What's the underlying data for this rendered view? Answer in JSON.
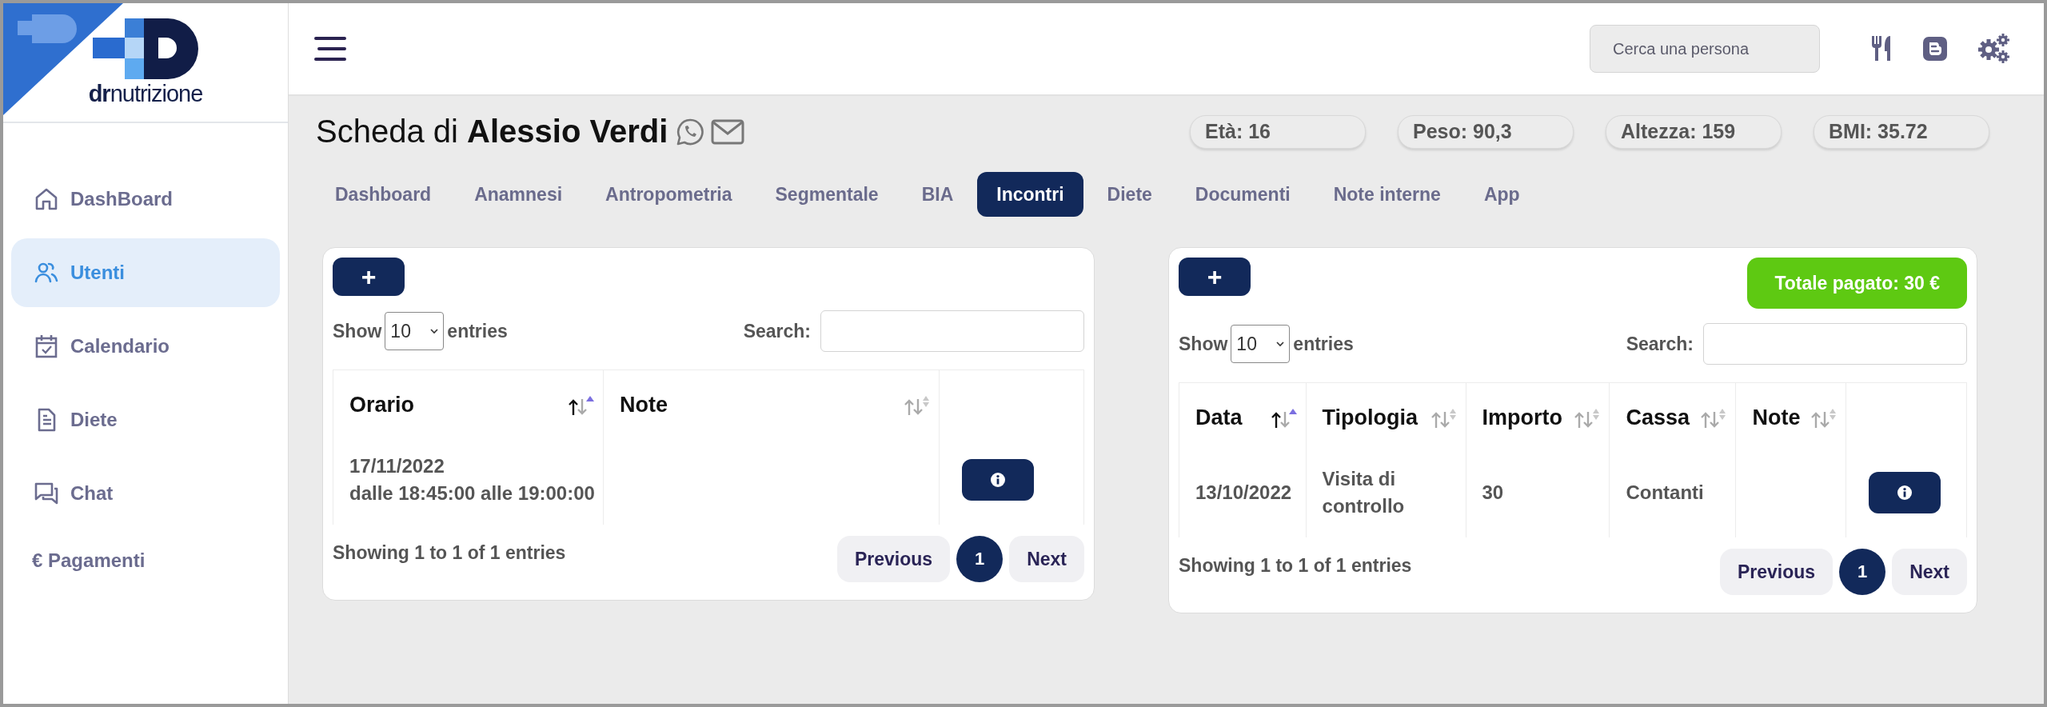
{
  "brand": {
    "logo_text": "**dr**nutrizione"
  },
  "sidebar": {
    "items": [
      {
        "label": "DashBoard",
        "kind": "home",
        "selected": false
      },
      {
        "label": "Utenti",
        "kind": "users",
        "selected": true
      },
      {
        "label": "Calendario",
        "kind": "calendar",
        "selected": false
      },
      {
        "label": "Diete",
        "kind": "document",
        "selected": false
      },
      {
        "label": "Chat",
        "kind": "chat",
        "selected": false
      },
      {
        "label": "€ Pagamenti",
        "kind": "plain",
        "selected": false
      }
    ]
  },
  "header": {
    "search": {
      "placeholder": "Cerca una persona"
    }
  },
  "patient": {
    "title": "Scheda di **Alessio Verdi**",
    "stats": [
      "Età: 16",
      "Peso: 90,3",
      "Altezza: 159",
      "BMI: 35.72"
    ]
  },
  "tabs": [
    {
      "label": "Dashboard",
      "selected": false
    },
    {
      "label": "Anamnesi",
      "selected": false
    },
    {
      "label": "Antropometria",
      "selected": false
    },
    {
      "label": "Segmentale",
      "selected": false
    },
    {
      "label": "BIA",
      "selected": false
    },
    {
      "label": "Incontri",
      "selected": true
    },
    {
      "label": "Diete",
      "selected": false
    },
    {
      "label": "Documenti",
      "selected": false
    },
    {
      "label": "Note interne",
      "selected": false
    },
    {
      "label": "App",
      "selected": false
    }
  ],
  "tables": [
    {
      "add_button": "+",
      "show_label": "Show",
      "page_length": "10",
      "entries_label": "entries",
      "search_label": "Search:",
      "columns": [
        {
          "label": "Orario",
          "sorted_ascending": true
        },
        {
          "label": "Note",
          "sorted_ascending": false
        }
      ],
      "rows": [
        {
          "cells": [
            "17/11/2022\ndalle 18:45:00 alle 19:00:00",
            null
          ],
          "kind": "info"
        }
      ],
      "info": "Showing 1 to 1 of 1 entries",
      "pagination": {
        "previous": "Previous",
        "pages": [
          {
            "label": "1",
            "selected": true
          }
        ],
        "next": "Next"
      }
    },
    {
      "add_button": "+",
      "total": "Totale pagato: 30 €",
      "show_label": "Show",
      "page_length": "10",
      "entries_label": "entries",
      "search_label": "Search:",
      "columns": [
        {
          "label": "Data",
          "sorted_ascending": true
        },
        {
          "label": "Tipologia",
          "sorted_ascending": false
        },
        {
          "label": "Importo",
          "sorted_ascending": false
        },
        {
          "label": "Cassa",
          "sorted_ascending": false
        },
        {
          "label": "Note",
          "sorted_ascending": false
        }
      ],
      "rows": [
        {
          "cells": [
            "13/10/2022",
            "Visita di controllo",
            "30",
            "Contanti",
            null
          ],
          "kind": "info"
        }
      ],
      "info": "Showing 1 to 1 of 1 entries",
      "pagination": {
        "previous": "Previous",
        "pages": [
          {
            "label": "1",
            "selected": true
          }
        ],
        "next": "Next"
      }
    }
  ]
}
